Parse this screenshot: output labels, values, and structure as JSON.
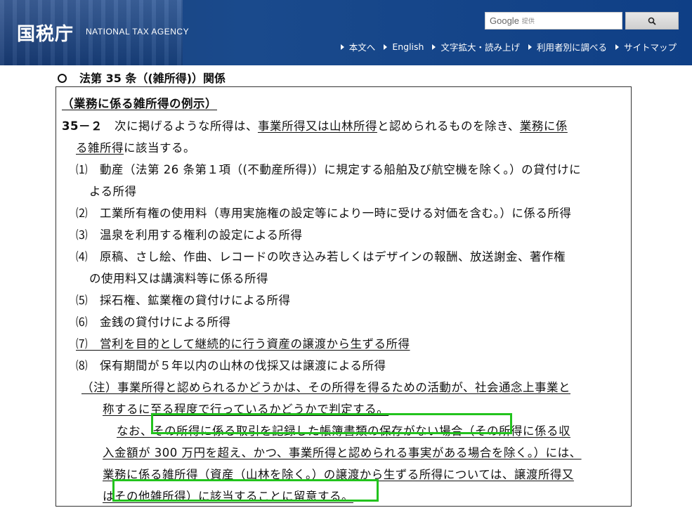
{
  "header": {
    "logo_kanji": "国税庁",
    "logo_en": "NATIONAL TAX AGENCY",
    "search_brand": "Google",
    "search_provided": "提供",
    "nav": [
      "本文へ",
      "English",
      "文字拡大・読み上げ",
      "利用者別に調べる",
      "サイトマップ"
    ]
  },
  "section_title": "法第 35 条（(雑所得)）関係",
  "doc": {
    "heading": "（業務に係る雑所得の例示）",
    "num": "35－２",
    "intro_1a": "次に掲げるような所得は、",
    "intro_1b": "事業所得又は山林所得",
    "intro_1c": "と認められるものを除き、",
    "intro_1d": "業務に係",
    "intro_2a": "る雑所得",
    "intro_2b": "に該当する。",
    "item1_a": "⑴　動産（法第 26 条第１項（(不動産所得)）に規定する船舶及び航空機を除く。）の貸付けに",
    "item1_b": "よる所得",
    "item2": "⑵　工業所有権の使用料（専用実施権の設定等により一時に受ける対価を含む。）に係る所得",
    "item3": "⑶　温泉を利用する権利の設定による所得",
    "item4_a": "⑷　原稿、さし絵、作曲、レコードの吹き込み若しくはデザインの報酬、放送謝金、著作権",
    "item4_b": "の使用料又は講演料等に係る所得",
    "item5": "⑸　採石権、鉱業権の貸付けによる所得",
    "item6": "⑹　金銭の貸付けによる所得",
    "item7": "⑺　営利を目的として継続的に行う資産の譲渡から生ずる所得",
    "item8": "⑻　保有期間が５年以内の山林の伐採又は譲渡による所得",
    "note_1": "（注）事業所得と認められるかどうかは、その所得を得るための活動が、社会通念上事業と",
    "note_2": "称するに至る程度で行っているかどうかで判定する。",
    "note_3a": "なお、",
    "note_3b": "その所得に係る取引を記録した帳簿書類の保存がない場合",
    "note_3c": "（その所得に係る収",
    "note_4": "入金額が 300 万円を超え、かつ、事業所得と認められる事実がある場合を除く。）には、",
    "note_5": "業務に係る雑所得（資産（山林を除く。）の譲渡から生ずる所得については、譲渡所得又",
    "note_6a": "は",
    "note_6b": "その他雑所得）に該当することに留意する。"
  },
  "highlight_color": "#22c31d"
}
